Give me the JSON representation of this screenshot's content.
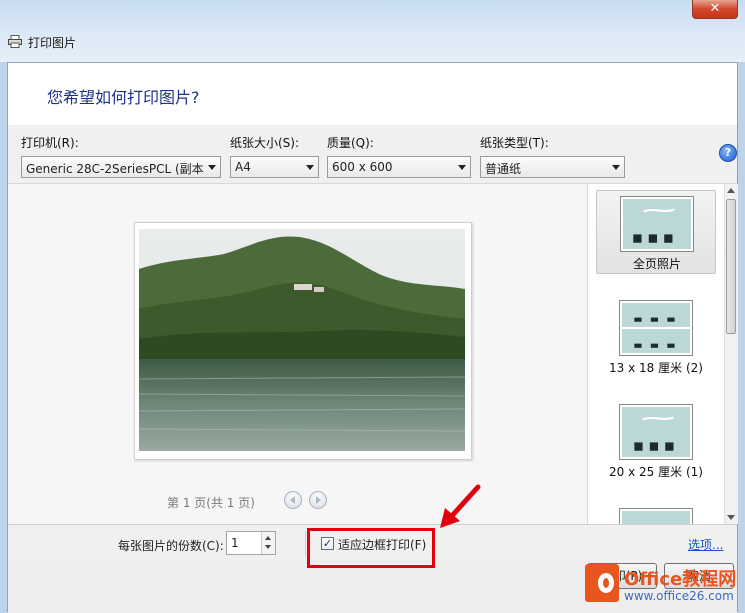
{
  "window": {
    "title": "打印图片",
    "close_symbol": "✕"
  },
  "header": {
    "question": "您希望如何打印图片?"
  },
  "settings": {
    "printer": {
      "label": "打印机(R):",
      "value": "Generic 28C-2SeriesPCL (副本 1)"
    },
    "paper_size": {
      "label": "纸张大小(S):",
      "value": "A4"
    },
    "quality": {
      "label": "质量(Q):",
      "value": "600 x 600"
    },
    "paper_type": {
      "label": "纸张类型(T):",
      "value": "普通纸"
    },
    "help_symbol": "?"
  },
  "preview": {
    "page_info": "第 1 页(共 1 页)"
  },
  "layouts": [
    {
      "label": "全页照片",
      "selected": true
    },
    {
      "label": "13 x 18 厘米 (2)",
      "selected": false
    },
    {
      "label": "20 x 25 厘米 (1)",
      "selected": false
    },
    {
      "label": "",
      "selected": false
    }
  ],
  "footer": {
    "copies_label": "每张图片的份数(C):",
    "copies_value": "1",
    "fit_to_frame": {
      "label": "适应边框打印(F)",
      "checked": true,
      "check_symbol": "✓"
    },
    "options_link": "选项..."
  },
  "buttons": {
    "print": "打印(P)",
    "cancel": "取消"
  },
  "watermark": {
    "brand": "Office",
    "brand_cn": "教程网",
    "url": "www.office26.com"
  },
  "colors": {
    "highlight": "#e0000f",
    "link": "#1451c2",
    "question": "#1e3287"
  }
}
